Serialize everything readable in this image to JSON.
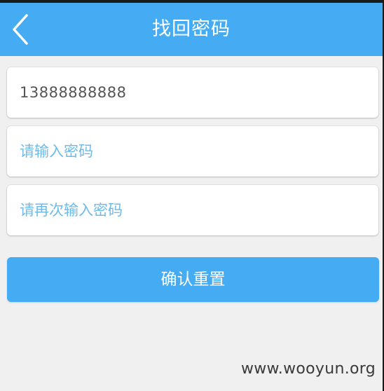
{
  "header": {
    "back_icon": "chevron-left-icon",
    "title": "找回密码"
  },
  "form": {
    "phone": {
      "value": "13888888888",
      "placeholder": ""
    },
    "password": {
      "value": "",
      "placeholder": "请输入密码"
    },
    "password_confirm": {
      "value": "",
      "placeholder": "请再次输入密码"
    }
  },
  "actions": {
    "confirm_label": "确认重置"
  },
  "watermark": {
    "text": "www.wooyun.org"
  },
  "colors": {
    "accent": "#45acf4",
    "background": "#f0f0f0",
    "placeholder": "#6cbbe9"
  }
}
